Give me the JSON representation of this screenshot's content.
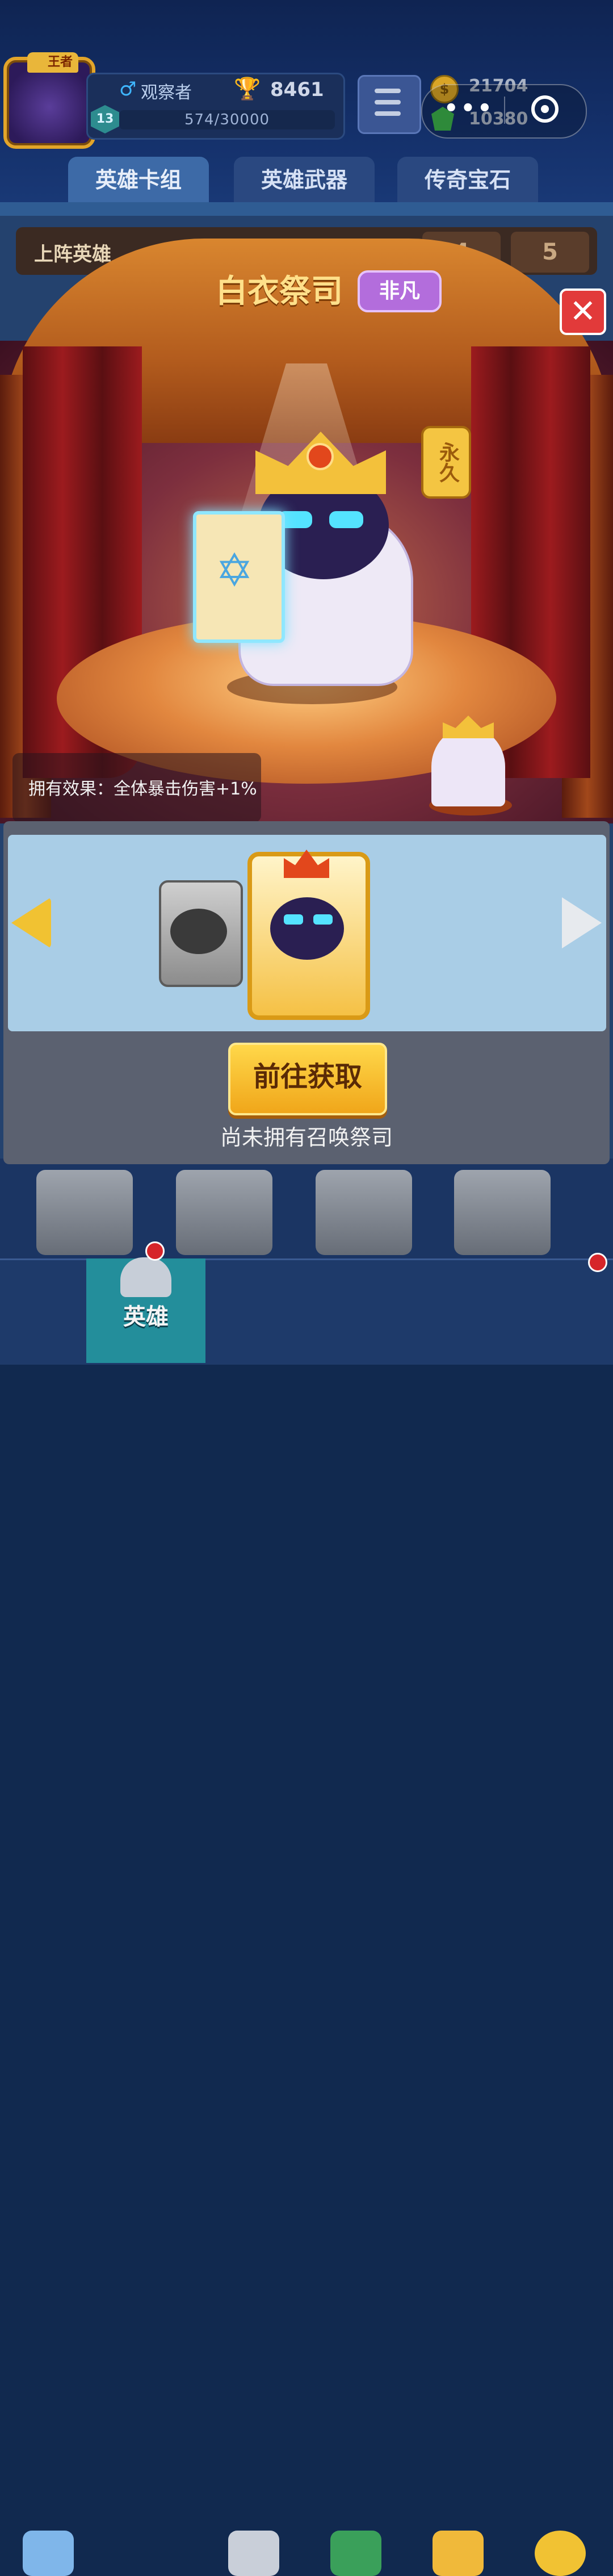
{
  "header": {
    "avatar_badge": "王者",
    "player_name": "观察者",
    "trophy_count": "8461",
    "level": "13",
    "exp": "574/30000",
    "coins": "21704",
    "gems": "10380"
  },
  "tabs": [
    {
      "label": "英雄卡组",
      "active": true
    },
    {
      "label": "英雄武器",
      "active": false
    },
    {
      "label": "传奇宝石",
      "active": false
    }
  ],
  "lineup": {
    "label": "上阵英雄",
    "slots": [
      "4",
      "5"
    ]
  },
  "modal": {
    "hero_name": "白衣祭司",
    "rarity": "非凡",
    "tag": "永久",
    "effect": "拥有效果：全体暴击伤害+1%",
    "get_button": "前往获取",
    "status": "尚未拥有召唤祭司"
  },
  "bottom_nav": {
    "active_label": "英雄"
  },
  "colors": {
    "accent_gold": "#f0a61a",
    "rarity_purple": "#b36ddc",
    "close_red": "#e23a3a",
    "nav_active": "#238e9b"
  }
}
